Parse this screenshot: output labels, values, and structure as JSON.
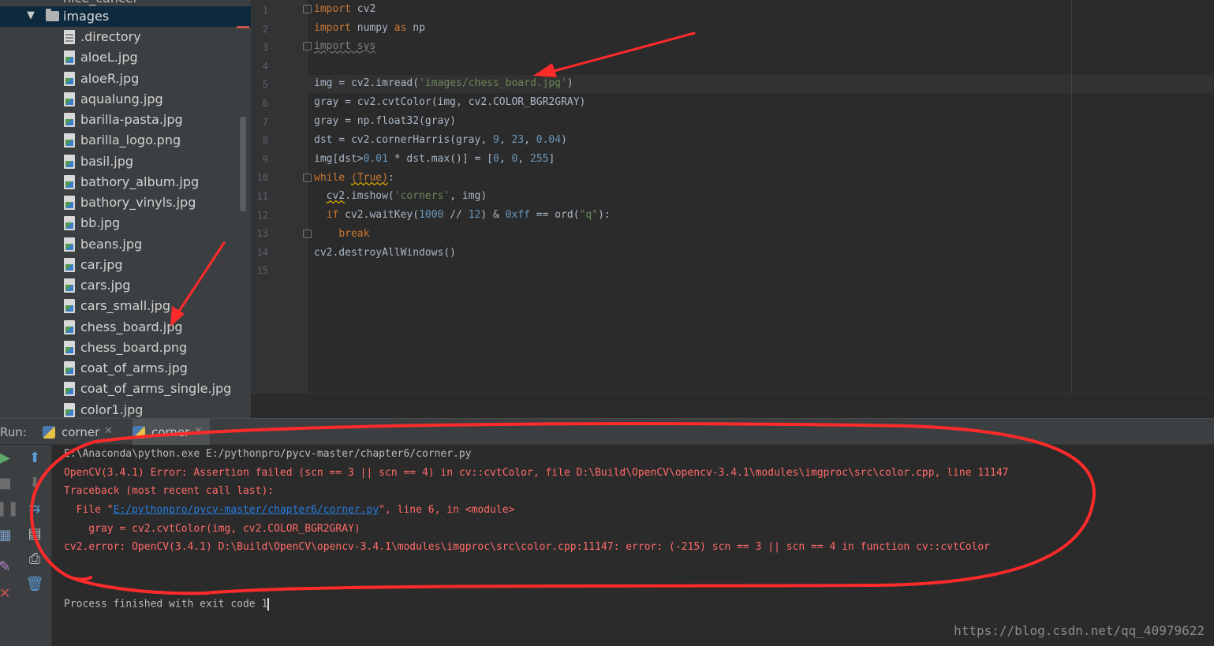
{
  "project_tree": {
    "cut_folder_label": "nice_cancel",
    "folder": {
      "label": "images",
      "expanded": true
    },
    "files": [
      {
        "name": ".directory",
        "kind": "doc"
      },
      {
        "name": "aloeL.jpg",
        "kind": "image"
      },
      {
        "name": "aloeR.jpg",
        "kind": "image"
      },
      {
        "name": "aqualung.jpg",
        "kind": "image"
      },
      {
        "name": "barilla-pasta.jpg",
        "kind": "image"
      },
      {
        "name": "barilla_logo.png",
        "kind": "image"
      },
      {
        "name": "basil.jpg",
        "kind": "image"
      },
      {
        "name": "bathory_album.jpg",
        "kind": "image"
      },
      {
        "name": "bathory_vinyls.jpg",
        "kind": "image"
      },
      {
        "name": "bb.jpg",
        "kind": "image"
      },
      {
        "name": "beans.jpg",
        "kind": "image"
      },
      {
        "name": "car.jpg",
        "kind": "image"
      },
      {
        "name": "cars.jpg",
        "kind": "image"
      },
      {
        "name": "cars_small.jpg",
        "kind": "image"
      },
      {
        "name": "chess_board.jpg",
        "kind": "image"
      },
      {
        "name": "chess_board.png",
        "kind": "image"
      },
      {
        "name": "coat_of_arms.jpg",
        "kind": "image"
      },
      {
        "name": "coat_of_arms_single.jpg",
        "kind": "image"
      },
      {
        "name": "color1.jpg",
        "kind": "image"
      }
    ]
  },
  "editor": {
    "line_numbers": [
      "1",
      "2",
      "3",
      "4",
      "5",
      "6",
      "7",
      "8",
      "9",
      "10",
      "11",
      "12",
      "13",
      "14",
      "15"
    ]
  },
  "run": {
    "label": "Run:",
    "tabs": [
      {
        "name": "corner",
        "active": false
      },
      {
        "name": "corner",
        "active": true
      }
    ],
    "console": {
      "command": "E:\\Anaconda\\python.exe E:/pythonpro/pycv-master/chapter6/corner.py",
      "error1": "OpenCV(3.4.1) Error: Assertion failed (scn == 3 || scn == 4) in cv::cvtColor, file D:\\Build\\OpenCV\\opencv-3.4.1\\modules\\imgproc\\src\\color.cpp, line 11147",
      "traceback": "Traceback (most recent call last):",
      "file_prefix": "  File \"",
      "file_link": "E:/pythonpro/pycv-master/chapter6/corner.py",
      "file_suffix": "\", line 6, in <module>",
      "code_line": "    gray = cv2.cvtColor(img, cv2.COLOR_BGR2GRAY)",
      "error2": "cv2.error: OpenCV(3.4.1) D:\\Build\\OpenCV\\opencv-3.4.1\\modules\\imgproc\\src\\color.cpp:11147: error: (-215) scn == 3 || scn == 4 in function cv::cvtColor",
      "finished": "Process finished with exit code 1"
    }
  },
  "watermark": "https://blog.csdn.net/qq_40979622",
  "colors": {
    "annotation": "#ff2a2a",
    "error_text": "#ff6b68",
    "keyword": "#cc7832",
    "string": "#6a8759",
    "number": "#6897bb",
    "selection": "#0d293e"
  }
}
